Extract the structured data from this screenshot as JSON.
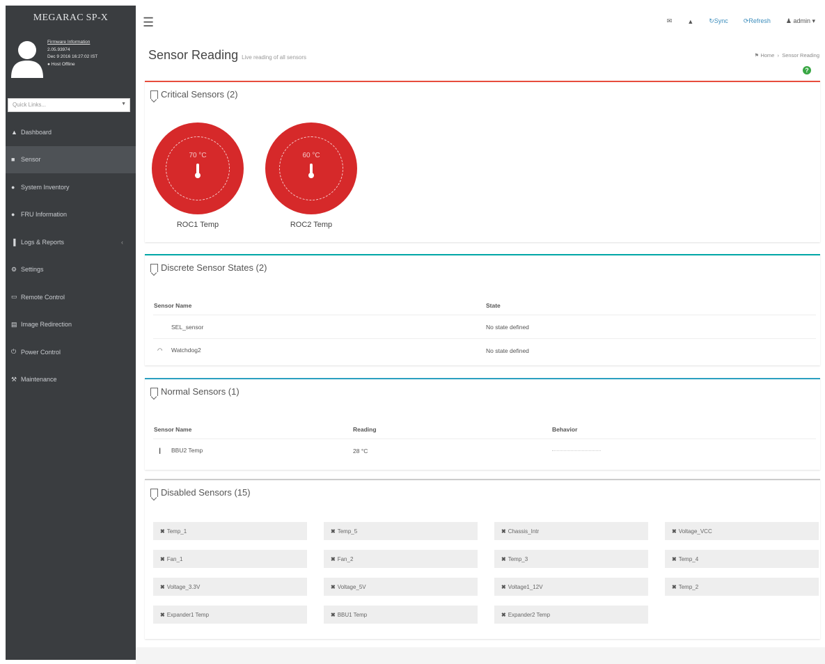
{
  "brand": "MEGARAC SP-X",
  "user": {
    "firmware_label": "Firmware Information",
    "version": "2.05.93974",
    "date": "Dec 9 2016 16:27:02 IST",
    "status": "Host Offline"
  },
  "quick_links": {
    "placeholder": "Quick Links..."
  },
  "nav": [
    {
      "label": "Dashboard",
      "icon": "home-icon",
      "glyph": "▲"
    },
    {
      "label": "Sensor",
      "icon": "sensor-icon",
      "glyph": "■",
      "active": true
    },
    {
      "label": "System Inventory",
      "icon": "inventory-icon",
      "glyph": "●"
    },
    {
      "label": "FRU Information",
      "icon": "info-icon",
      "glyph": "●"
    },
    {
      "label": "Logs & Reports",
      "icon": "chart-icon",
      "glyph": "▐",
      "chevron": "‹"
    },
    {
      "label": "Settings",
      "icon": "gear-icon",
      "glyph": "⚙"
    },
    {
      "label": "Remote Control",
      "icon": "monitor-icon",
      "glyph": "▭"
    },
    {
      "label": "Image Redirection",
      "icon": "image-icon",
      "glyph": "▤"
    },
    {
      "label": "Power Control",
      "icon": "power-icon",
      "glyph": "⏻"
    },
    {
      "label": "Maintenance",
      "icon": "wrench-icon",
      "glyph": "⚒"
    }
  ],
  "topbar": {
    "sync_label": "Sync",
    "refresh_label": "Refresh",
    "user_label": "admin"
  },
  "page": {
    "title": "Sensor Reading",
    "subtitle": "Live reading of all sensors",
    "breadcrumb_home": "Home",
    "breadcrumb_current": "Sensor Reading"
  },
  "critical": {
    "title": "Critical Sensors (2)",
    "sensors": [
      {
        "name": "ROC1 Temp",
        "value": "70 °C"
      },
      {
        "name": "ROC2 Temp",
        "value": "60 °C"
      }
    ]
  },
  "discrete": {
    "title": "Discrete Sensor States (2)",
    "col_name": "Sensor Name",
    "col_state": "State",
    "rows": [
      {
        "name": "SEL_sensor",
        "state": "No state defined"
      },
      {
        "name": "Watchdog2",
        "state": "No state defined"
      }
    ]
  },
  "normal": {
    "title": "Normal Sensors (1)",
    "col_name": "Sensor Name",
    "col_reading": "Reading",
    "col_behavior": "Behavior",
    "rows": [
      {
        "name": "BBU2 Temp",
        "reading": "28 °C"
      }
    ]
  },
  "disabled": {
    "title": "Disabled Sensors (15)",
    "items": [
      "Temp_1",
      "Temp_5",
      "Chassis_Intr",
      "Voltage_VCC",
      "Fan_1",
      "Fan_2",
      "Temp_3",
      "Temp_4",
      "Voltage_3.3V",
      "Voltage_5V",
      "Voltage1_12V",
      "Temp_2",
      "Expander1 Temp",
      "BBU1 Temp",
      "Expander2 Temp"
    ]
  },
  "colors": {
    "critical": "#d6292a",
    "sidebar": "#3a3d40",
    "accent": "#3c8dbc"
  }
}
